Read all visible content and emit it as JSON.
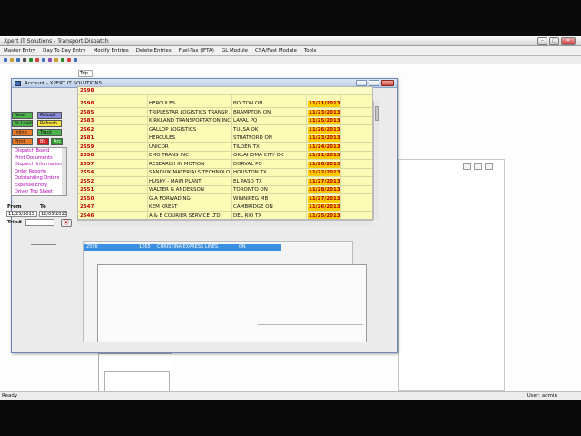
{
  "window": {
    "title": "Xpert IT Solutions - Transport Dispatch",
    "minimize": "–",
    "maximize": "□",
    "close": "✕"
  },
  "menu": [
    "Master Entry",
    "Day To Day Entry",
    "Modify Entries",
    "Delete Entries",
    "Fuel-Tax (IFTA)",
    "GL Module",
    "CSA/Fast Module",
    "Tools"
  ],
  "background": {
    "tab_label": "Trip"
  },
  "account_window": {
    "title": "Account - XPERT IT SOLUTIONS",
    "buttons": {
      "new": "New",
      "reload": "Reload",
      "st_load": "St Load",
      "refresh": "Refresh",
      "inline": "Inline",
      "track": "Track",
      "print": "Print",
      "b1": "Bk",
      "b2": "Arc"
    },
    "dispatch_menu": [
      "Dispatch Board",
      "Print Documents",
      "Dispatch Information",
      "Order Reports",
      "Outstanding Orders",
      "Expense Entry",
      "Driver Trip Sheet"
    ],
    "from_label": "From",
    "to_label": "To",
    "from_date": "11/25/2013",
    "to_date": "12/05/2013",
    "trip_label": "Trip#",
    "grid_header_id": "2598",
    "rows": [
      {
        "id": "2598",
        "name": "HERCULES",
        "city": "BOLTON  ON",
        "date": "11/21/2013"
      },
      {
        "id": "2585",
        "name": "TRIPLESTAR LOGISTICS TRANSP...",
        "city": "BRAMPTON  ON",
        "date": "11/23/2013"
      },
      {
        "id": "2583",
        "name": "KIRKLAND TRANSPORTATION INC",
        "city": "LAVAL  PQ",
        "date": "11/25/2013"
      },
      {
        "id": "2562",
        "name": "GALLOP LOGISTICS",
        "city": "TULSA  OK",
        "date": "11/26/2013"
      },
      {
        "id": "2581",
        "name": "HERCULES",
        "city": "STRATFORD  ON",
        "date": "11/23/2013"
      },
      {
        "id": "2559",
        "name": "UNICOR",
        "city": "TILDEN  TX",
        "date": "11/24/2013"
      },
      {
        "id": "2558",
        "name": "EMO TRANS INC",
        "city": "OKLAHOMA CITY  OK",
        "date": "11/21/2013"
      },
      {
        "id": "2557",
        "name": "RESEARCH IN MOTION",
        "city": "DORVAL  PQ",
        "date": "11/26/2013"
      },
      {
        "id": "2554",
        "name": "SANDVIK MATERIALS TECHNOLO...",
        "city": "HOUSTON  TX",
        "date": "11/22/2013"
      },
      {
        "id": "2552",
        "name": "HUSKY - MAIN PLANT",
        "city": "EL PASO  TX",
        "date": "11/27/2013"
      },
      {
        "id": "2551",
        "name": "WALTER G ANDERSON",
        "city": "TORONTO  ON",
        "date": "11/28/2013"
      },
      {
        "id": "2550",
        "name": "G.A FORWADING",
        "city": "WINNIPEG  MB",
        "date": "11/27/2013"
      },
      {
        "id": "2547",
        "name": "KEM KREST",
        "city": "CAMBRIDGE  ON",
        "date": "11/26/2013"
      },
      {
        "id": "2546",
        "name": "A & B COURIER SERVICE LTD",
        "city": "DEL RIO  TX",
        "date": "11/25/2013"
      }
    ],
    "selected_row": {
      "a": "2596",
      "b": "1265",
      "name": "CHRISTINA EXPRESS LINES",
      "city": "ON"
    }
  },
  "status": {
    "left": "Ready",
    "right": "User:  admin"
  },
  "colors": {
    "grid_bg": "#fbfbb6",
    "date_cell": "#ffcc00",
    "id_text": "#c00000",
    "menu_text": "#b400b4",
    "selection": "#3b8fe0"
  }
}
